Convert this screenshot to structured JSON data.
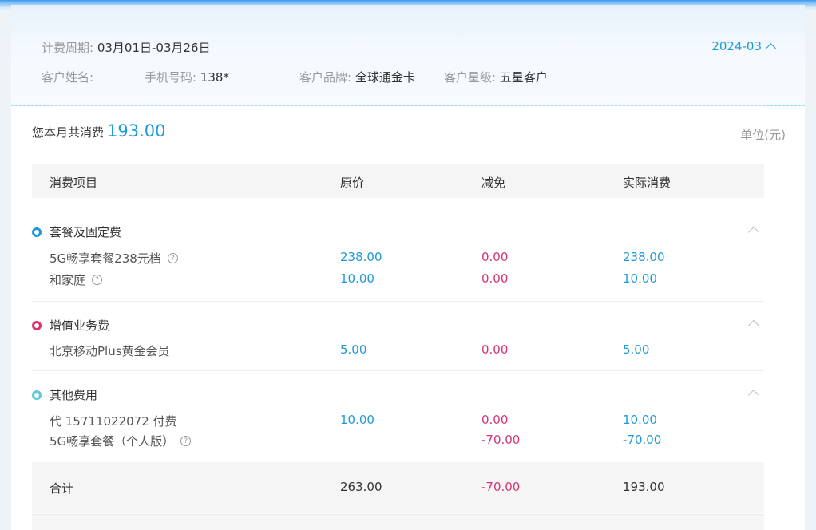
{
  "header": {
    "period_label": "计费周期:",
    "period_value": "03月01日-03月26日",
    "month": "2024-03",
    "customer_name_label": "客户姓名:",
    "customer_name_value": "",
    "phone_label": "手机号码:",
    "phone_value": "138*",
    "brand_label": "客户品牌:",
    "brand_value": "全球通金卡",
    "star_label": "客户星级:",
    "star_value": "五星客户"
  },
  "summary": {
    "prefix": "您本月共消费",
    "amount": "193.00",
    "unit": "单位(元)"
  },
  "table": {
    "columns": [
      "消费项目",
      "原价",
      "减免",
      "实际消费"
    ],
    "sections": [
      {
        "title": "套餐及固定费",
        "dot_color": "#1f9ad8",
        "rows": [
          {
            "name": "5G畅享套餐238元档",
            "original": "238.00",
            "discount": "0.00",
            "actual": "238.00",
            "help": true
          },
          {
            "name": "和家庭",
            "original": "10.00",
            "discount": "0.00",
            "actual": "10.00",
            "help": true
          }
        ]
      },
      {
        "title": "增值业务费",
        "dot_color": "#e0306b",
        "rows": [
          {
            "name": "北京移动Plus黄金会员",
            "original": "5.00",
            "discount": "0.00",
            "actual": "5.00",
            "help": false
          }
        ]
      },
      {
        "title": "其他费用",
        "dot_color": "#5cc8dc",
        "rows": [
          {
            "name": "代 15711022072 付费",
            "original": "10.00",
            "discount": "0.00",
            "actual": "10.00",
            "help": false
          },
          {
            "name": "5G畅享套餐（个人版）",
            "original": "",
            "discount": "-70.00",
            "actual": "-70.00",
            "help": true
          }
        ]
      }
    ],
    "total": {
      "label": "合计",
      "original": "263.00",
      "discount": "-70.00",
      "actual": "193.00"
    }
  },
  "icons": {
    "help": "help-circle-icon",
    "collapse": "chevron-up-icon",
    "help_glyph": "?"
  }
}
